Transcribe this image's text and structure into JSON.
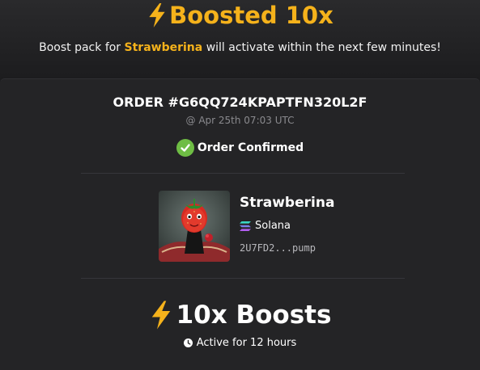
{
  "header": {
    "title": "Boosted 10x",
    "subtitle_prefix": "Boost pack for",
    "token_name": "Strawberina",
    "subtitle_suffix": "will activate within the next few minutes!"
  },
  "order": {
    "id": "ORDER #G6QQ724KPAPTFN320L2F",
    "timestamp": "@ Apr 25th 07:03 UTC",
    "status": "Order Confirmed"
  },
  "token": {
    "name": "Strawberina",
    "chain": "Solana",
    "address": "2U7FD2...pump",
    "image_icon": "strawberry-character-avatar"
  },
  "boost": {
    "label": "10x Boosts",
    "duration": "Active for 12 hours"
  },
  "colors": {
    "accent": "#f5b21b",
    "confirmed_green": "#6ebd44",
    "background": "#1b1b1d",
    "card": "#242426"
  }
}
